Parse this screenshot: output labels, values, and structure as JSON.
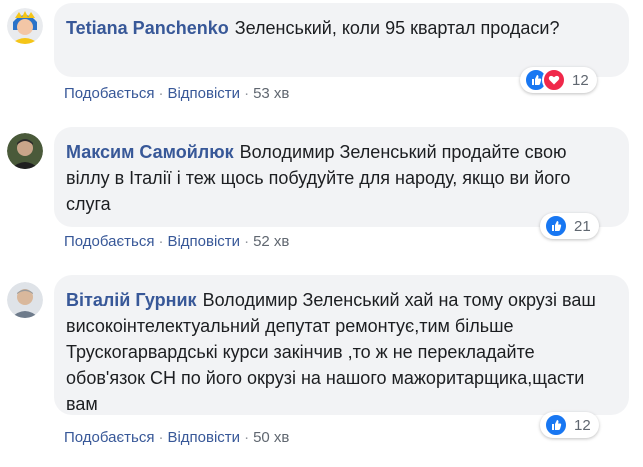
{
  "comments": [
    {
      "author": "Tetiana Panchenko",
      "text": "Зеленський, коли 95 квартал продаси?",
      "like_label": "Подобається",
      "reply_label": "Відповісти",
      "time": "53 хв",
      "reaction_count": "12",
      "reactions": [
        "like-icon",
        "love-icon"
      ]
    },
    {
      "author": "Максим Самойлюк",
      "text": "Володимир Зеленський продайте свою віллу в Італії і теж щось побудуйте для народу, якщо ви його слуга",
      "like_label": "Подобається",
      "reply_label": "Відповісти",
      "time": "52 хв",
      "reaction_count": "21",
      "reactions": [
        "like-icon"
      ]
    },
    {
      "author": "Віталій Гурник",
      "text": "Володимир Зеленський хай на тому окрузі ваш високоінтелектуальний депутат ремонтує,тим більше Трускогарвардські курси закінчив ,то ж не перекладайте обов'язок СН по його окрузі на нашого мажоритарщика,щасти вам",
      "like_label": "Подобається",
      "reply_label": "Відповісти",
      "time": "50 хв",
      "reaction_count": "12",
      "reactions": [
        "like-icon"
      ]
    }
  ],
  "colors": {
    "author": "#385898",
    "bubble": "#f2f3f5",
    "like": "#1877f2",
    "love": "#f0284a"
  }
}
